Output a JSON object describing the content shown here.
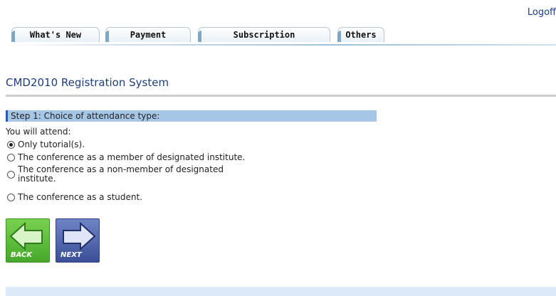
{
  "header": {
    "logoff_label": "Logoff"
  },
  "tabs": [
    {
      "label": "What's New"
    },
    {
      "label": "Payment"
    },
    {
      "label": "Subscription"
    },
    {
      "label": "Others"
    }
  ],
  "page": {
    "title": "CMD2010 Registration System"
  },
  "step": {
    "heading": "Step 1: Choice of attendance type:"
  },
  "form": {
    "prompt": "You will attend:",
    "options": [
      {
        "label": "Only tutorial(s).",
        "selected": true
      },
      {
        "label": "The conference as a member of designated institute.",
        "selected": false
      },
      {
        "label": "The conference as a non-member of designated institute.",
        "selected": false
      },
      {
        "label": "The conference as a student.",
        "selected": false
      }
    ]
  },
  "buttons": {
    "back_label": "BACK",
    "next_label": "NEXT"
  },
  "colors": {
    "accent_link": "#1a3f8a",
    "step_bar": "#a6c6e5",
    "back_button": "#46a82b",
    "next_button": "#3b4f98"
  }
}
